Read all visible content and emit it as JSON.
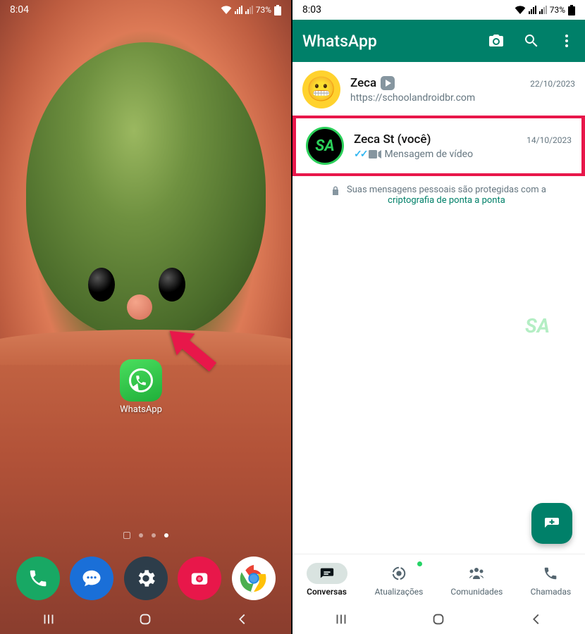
{
  "left": {
    "time": "8:04",
    "battery": "73%",
    "app_label": "WhatsApp",
    "dock": [
      "phone",
      "messages",
      "settings",
      "camera",
      "chrome"
    ]
  },
  "right": {
    "time": "8:03",
    "battery": "73%",
    "header_title": "WhatsApp",
    "chats": [
      {
        "name_prefix": "Zeca",
        "preview": "https://schoolandroidbr.com",
        "date": "22/10/2023"
      },
      {
        "name": "Zeca St (você)",
        "preview": "Mensagem de vídeo",
        "date": "14/10/2023"
      }
    ],
    "encryption_text": "Suas mensagens pessoais são protegidas com a",
    "encryption_link": "criptografia de ponta a ponta",
    "tabs": {
      "conversas": "Conversas",
      "atualizacoes": "Atualizações",
      "comunidades": "Comunidades",
      "chamadas": "Chamadas"
    }
  }
}
